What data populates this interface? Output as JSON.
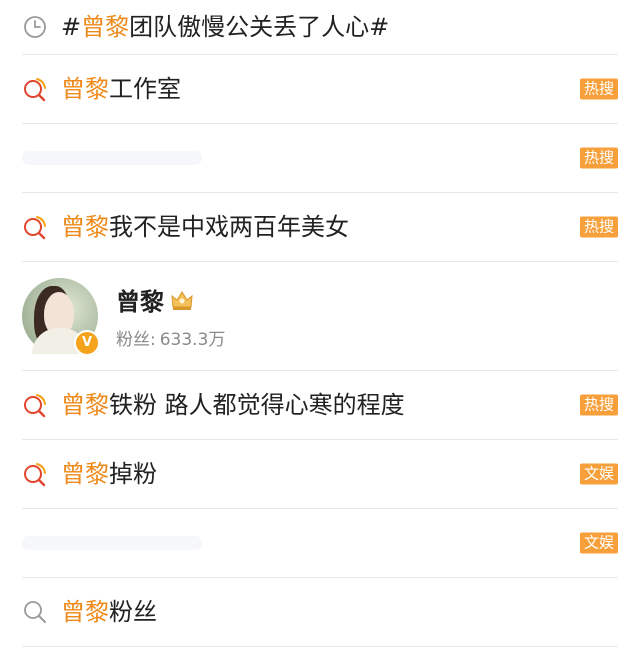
{
  "rows": [
    {
      "type": "history",
      "icon": "clock-icon",
      "prefix": "#",
      "hl": "曾黎",
      "rest": "团队傲慢公关丢了人心#",
      "badge": ""
    },
    {
      "type": "hot",
      "icon": "hot-search-icon",
      "hl": "曾黎",
      "rest": "工作室",
      "badge": "热搜"
    },
    {
      "type": "blurred",
      "badge": "热搜"
    },
    {
      "type": "hot",
      "icon": "hot-search-icon",
      "hl": "曾黎",
      "rest": "我不是中戏两百年美女",
      "badge": "热搜"
    },
    {
      "type": "user",
      "name": "曾黎",
      "fans_label": "粉丝:",
      "fans_value": "633.3万"
    },
    {
      "type": "hot",
      "icon": "hot-search-icon",
      "hl": "曾黎",
      "rest": "铁粉 路人都觉得心寒的程度",
      "badge": "热搜"
    },
    {
      "type": "hot",
      "icon": "hot-search-icon",
      "hl": "曾黎",
      "rest": "掉粉",
      "badge": "文娱"
    },
    {
      "type": "blurred",
      "badge": "文娱"
    },
    {
      "type": "search",
      "icon": "search-icon",
      "hl": "曾黎",
      "rest": "粉丝",
      "badge": ""
    }
  ],
  "colors": {
    "accent": "#ef8a1a",
    "badge_bg": "#f7a03b",
    "divider": "#e7e7e7"
  }
}
